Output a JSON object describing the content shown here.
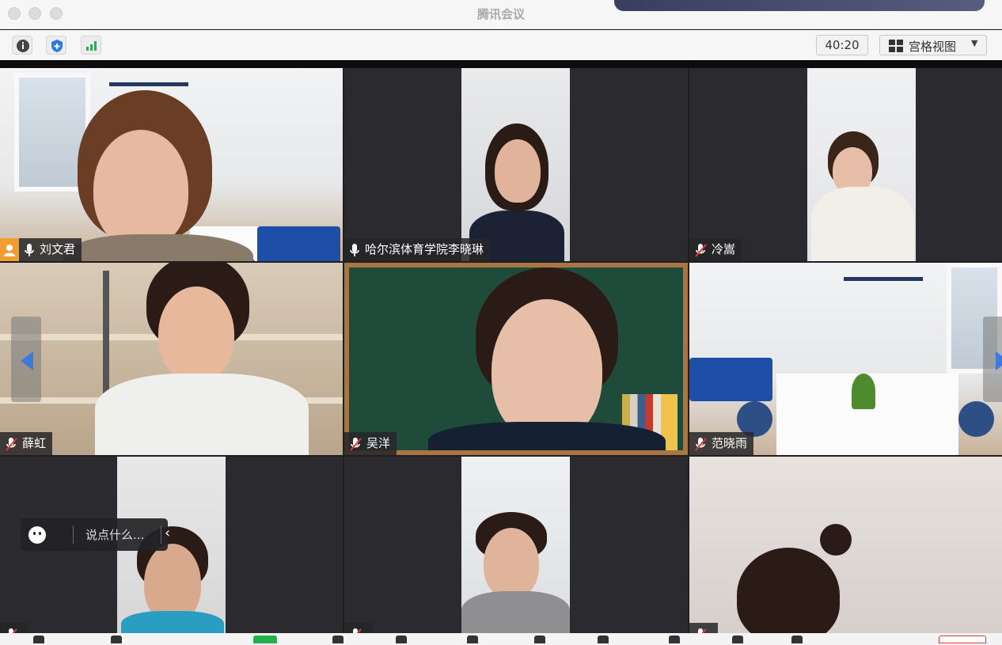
{
  "window": {
    "title": "腾讯会议"
  },
  "toolbar": {
    "timer": "40:20",
    "view_mode": "宫格视图"
  },
  "tiles": [
    {
      "name": "刘文君",
      "mic": "on",
      "host": true,
      "active": true
    },
    {
      "name": "哈尔滨体育学院李晓琳",
      "mic": "on"
    },
    {
      "name": "冷嵩",
      "mic": "muted"
    },
    {
      "name": "薛虹",
      "mic": "muted"
    },
    {
      "name": "吴洋",
      "mic": "muted"
    },
    {
      "name": "范晓雨",
      "mic": "muted"
    },
    {
      "name": "",
      "mic": "muted"
    },
    {
      "name": "",
      "mic": "muted"
    },
    {
      "name": "",
      "mic": "muted"
    }
  ],
  "chat": {
    "placeholder": "说点什么..."
  },
  "colors": {
    "active_border": "#22c55e",
    "host_badge": "#f39c2f",
    "accent_blue": "#3d7bdb"
  }
}
